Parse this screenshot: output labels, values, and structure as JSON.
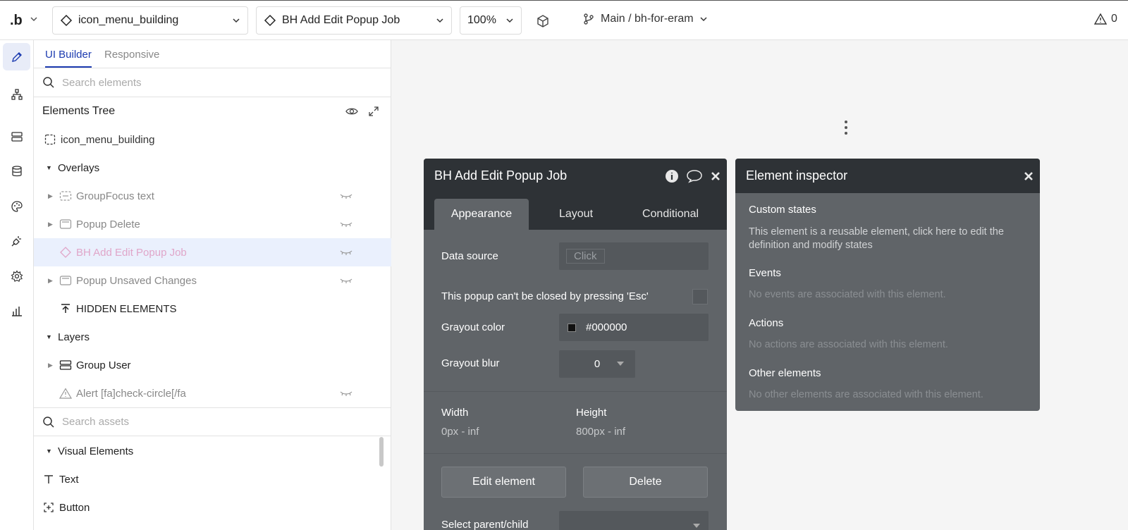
{
  "topbar": {
    "logo": ".b",
    "page_selector": "icon_menu_building",
    "element_selector": "BH Add Edit Popup Job",
    "zoom": "100%",
    "branch": "Main / bh-for-eram",
    "issues_count": "0"
  },
  "rail": {
    "items": [
      "design",
      "workflow",
      "data",
      "database",
      "styles",
      "plugins",
      "settings",
      "logs"
    ]
  },
  "panel": {
    "tabs": [
      "UI Builder",
      "Responsive"
    ],
    "search_placeholder": "Search elements",
    "tree_title": "Elements Tree",
    "root": "icon_menu_building",
    "overlays_label": "Overlays",
    "overlays": [
      {
        "label": "GroupFocus text"
      },
      {
        "label": "Popup Delete"
      },
      {
        "label": "BH Add Edit Popup Job"
      },
      {
        "label": "Popup Unsaved Changes"
      }
    ],
    "hidden_elements": "HIDDEN ELEMENTS",
    "layers_label": "Layers",
    "layers": [
      {
        "label": "Group User"
      },
      {
        "label": "Alert [fa]check-circle[/fa"
      }
    ],
    "assets_placeholder": "Search assets",
    "visual_elements_label": "Visual Elements",
    "visual_elements": [
      "Text",
      "Button"
    ]
  },
  "property_editor": {
    "title": "BH Add Edit Popup Job",
    "tabs": [
      "Appearance",
      "Layout",
      "Conditional"
    ],
    "data_source_label": "Data source",
    "data_source_button": "Click",
    "esc_label": "This popup can't be closed by pressing 'Esc'",
    "grayout_color_label": "Grayout color",
    "grayout_color_value": "#000000",
    "grayout_blur_label": "Grayout blur",
    "grayout_blur_value": "0",
    "width_label": "Width",
    "width_value": "0px - inf",
    "height_label": "Height",
    "height_value": "800px - inf",
    "edit_button": "Edit element",
    "delete_button": "Delete",
    "select_parent_label": "Select parent/child"
  },
  "inspector": {
    "title": "Element inspector",
    "custom_states_label": "Custom states",
    "custom_states_text": "This element is a reusable element, click here to edit the definition and modify states",
    "events_label": "Events",
    "events_text": "No events are associated with this element.",
    "actions_label": "Actions",
    "actions_text": "No actions are associated with this element.",
    "other_label": "Other elements",
    "other_text": "No other elements are associated with this element."
  },
  "colors": {
    "accent": "#1c3bb0",
    "editor_bg": "#606468",
    "editor_header": "#2e3236",
    "selection": "#eaf0fd"
  }
}
